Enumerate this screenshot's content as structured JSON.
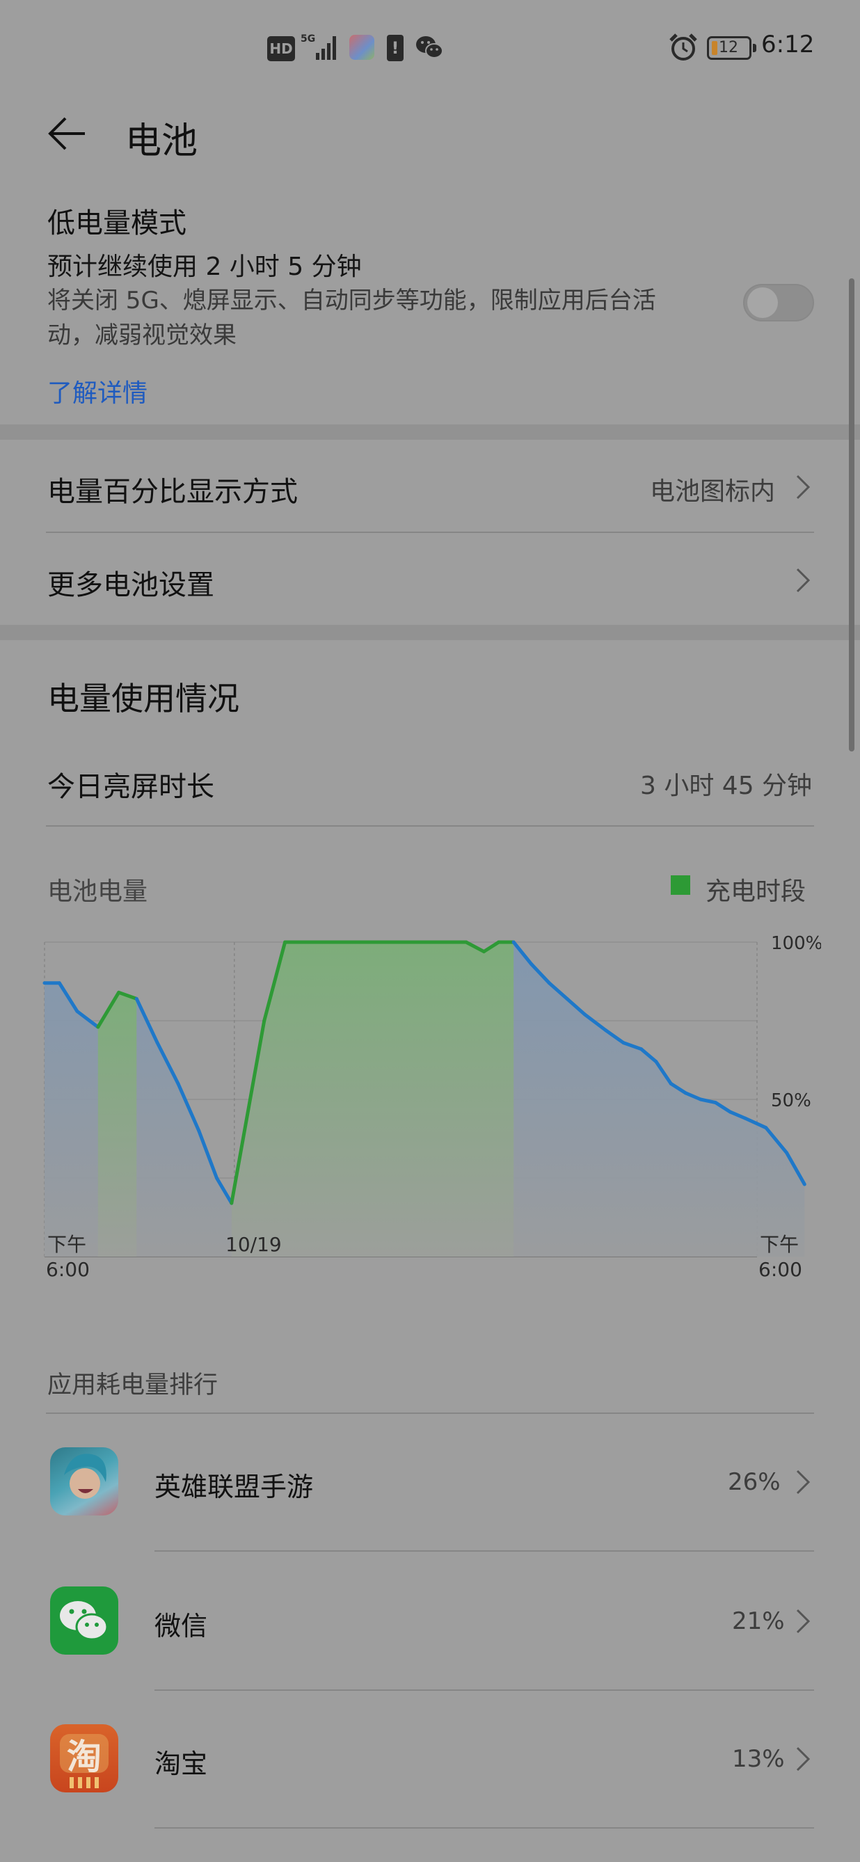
{
  "status_bar": {
    "hd": "HD",
    "network": "5G",
    "battery_level": "12",
    "time": "6:12",
    "icons": [
      "hd-icon",
      "signal-icon",
      "app-notification-icon",
      "battery-warning-icon",
      "wechat-icon",
      "alarm-icon",
      "battery-icon"
    ]
  },
  "header": {
    "title": "电池",
    "back_icon": "back-arrow-icon"
  },
  "low_power": {
    "title": "低电量模式",
    "estimate": "预计继续使用 2 小时 5 分钟",
    "desc_line1": "将关闭 5G、熄屏显示、自动同步等功能，限制应用后台活",
    "desc_line2": "动，减弱视觉效果",
    "learn_more": "了解详情",
    "enabled": false
  },
  "settings": {
    "percentage_display": {
      "label": "电量百分比显示方式",
      "value": "电池图标内"
    },
    "more_battery": {
      "label": "更多电池设置"
    }
  },
  "usage": {
    "section_title": "电量使用情况",
    "screen_on_label": "今日亮屏时长",
    "screen_on_value": "3 小时 45 分钟",
    "chart_label": "电池电量",
    "legend_label": "充电时段"
  },
  "chart_data": {
    "type": "area",
    "y_ticks": [
      "100%",
      "50%"
    ],
    "x_ticks": [
      {
        "line1": "下午",
        "line2": "6:00"
      },
      {
        "line1": "10/19",
        "line2": ""
      },
      {
        "line1": "下午",
        "line2": "6:00"
      }
    ],
    "ylim": [
      0,
      100
    ],
    "xlim": [
      0,
      24
    ],
    "series": [
      {
        "name": "电池电量",
        "color": "#1f78c8",
        "points": [
          [
            0,
            87
          ],
          [
            0.5,
            87
          ],
          [
            1.1,
            78
          ],
          [
            1.8,
            73
          ],
          [
            2.5,
            84
          ],
          [
            3.1,
            82
          ],
          [
            3.8,
            68
          ],
          [
            4.5,
            55
          ],
          [
            5.2,
            40
          ],
          [
            5.8,
            25
          ],
          [
            6.3,
            17
          ],
          [
            7.4,
            75
          ],
          [
            8.1,
            100
          ],
          [
            14.2,
            100
          ],
          [
            14.8,
            97
          ],
          [
            15.3,
            100
          ],
          [
            15.8,
            100
          ],
          [
            16.4,
            93
          ],
          [
            17.0,
            87
          ],
          [
            17.6,
            82
          ],
          [
            18.2,
            77
          ],
          [
            18.9,
            72
          ],
          [
            19.5,
            68
          ],
          [
            20.1,
            66
          ],
          [
            20.6,
            62
          ],
          [
            21.1,
            55
          ],
          [
            21.6,
            52
          ],
          [
            22.1,
            50
          ],
          [
            22.6,
            49
          ],
          [
            23.1,
            46
          ],
          [
            23.6,
            44
          ],
          [
            24.3,
            41
          ],
          [
            25.0,
            33
          ],
          [
            25.6,
            23
          ]
        ]
      }
    ],
    "charging_periods": [
      [
        1.8,
        3.1
      ],
      [
        6.3,
        15.8
      ]
    ],
    "grid": true
  },
  "app_ranking": {
    "title": "应用耗电量排行",
    "apps": [
      {
        "name": "英雄联盟手游",
        "percent": "26%",
        "icon": "league-of-legends-icon"
      },
      {
        "name": "微信",
        "percent": "21%",
        "icon": "wechat-app-icon"
      },
      {
        "name": "淘宝",
        "percent": "13%",
        "icon": "taobao-app-icon"
      }
    ]
  }
}
